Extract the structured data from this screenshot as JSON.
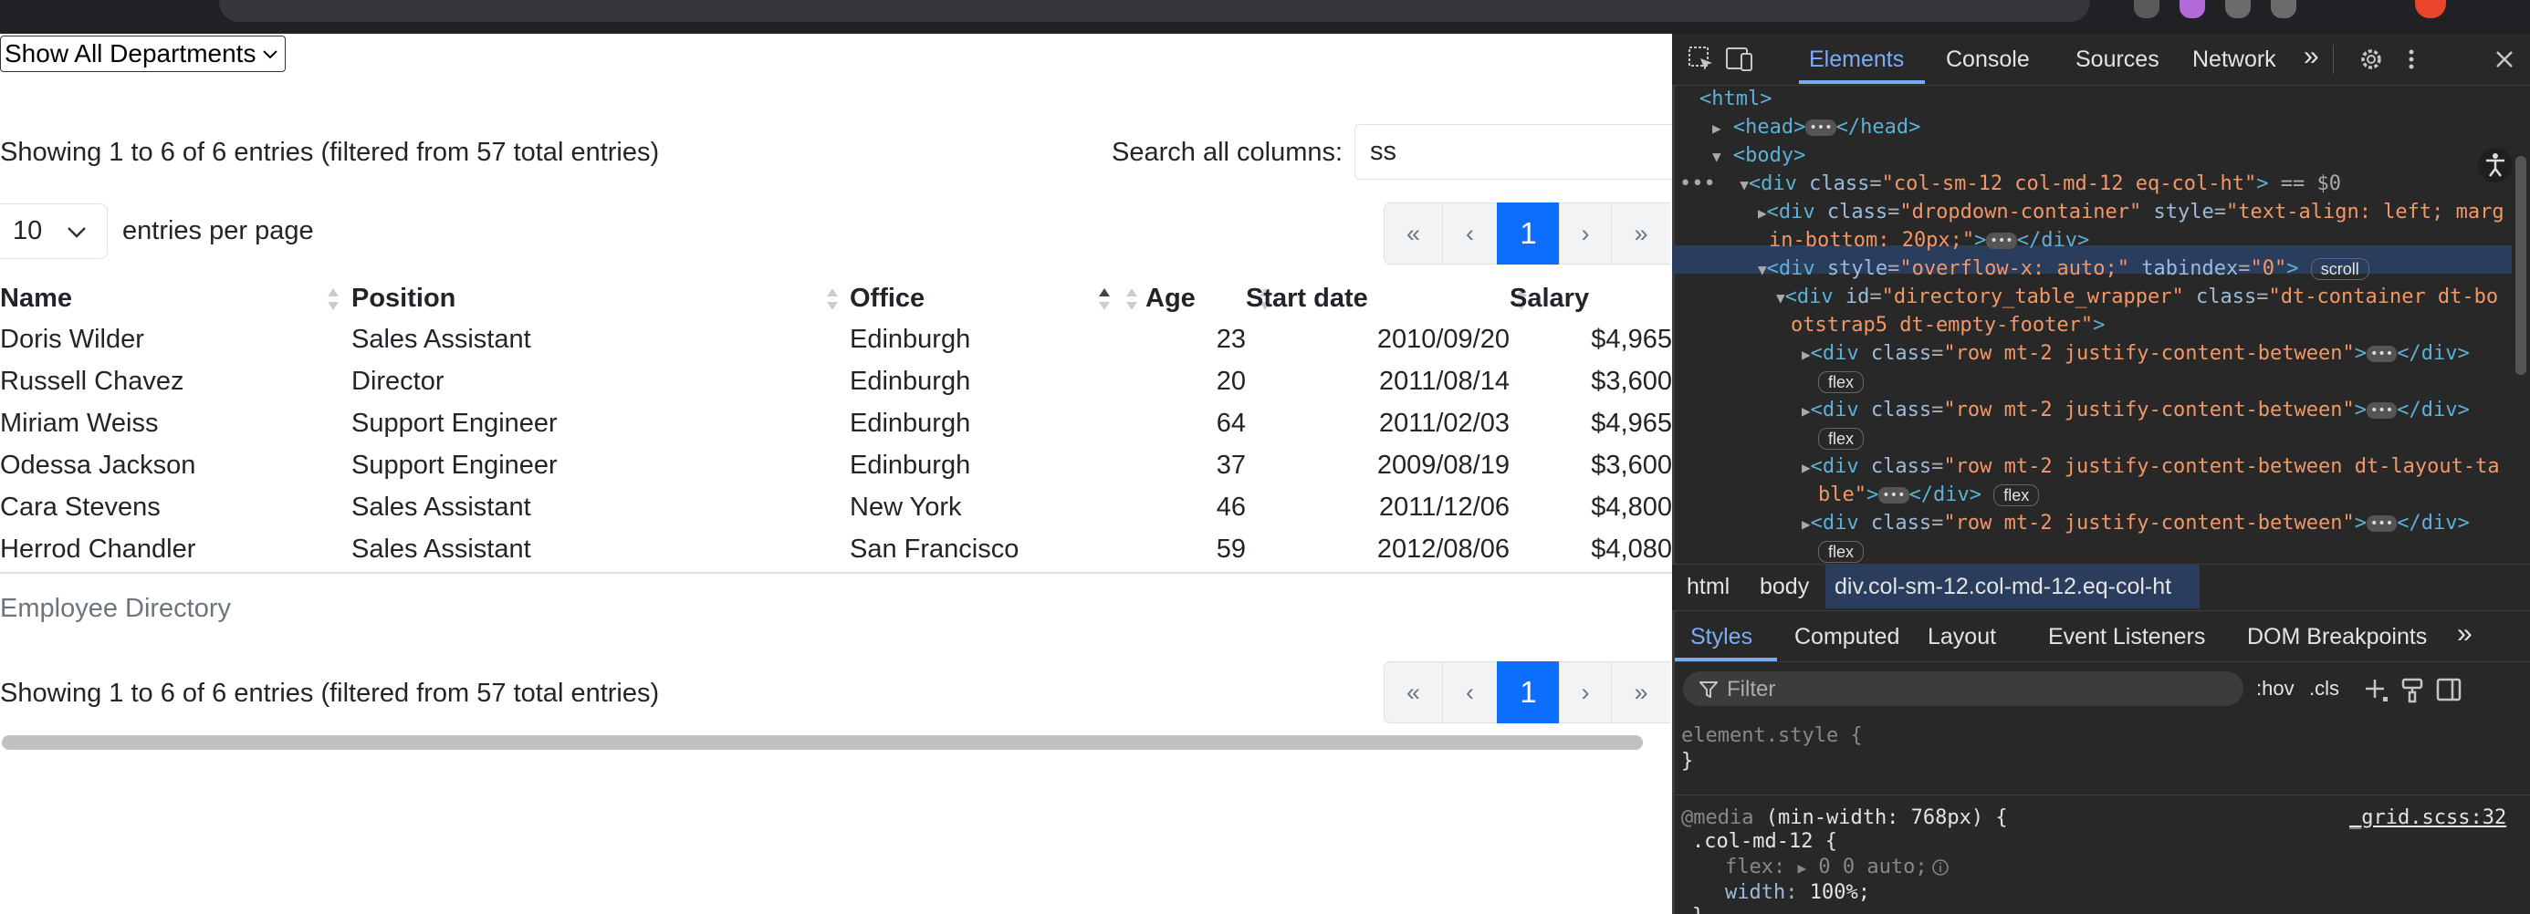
{
  "page": {
    "department_select": "Show All Departments",
    "info_top": "Showing 1 to 6 of 6 entries (filtered from 57 total entries)",
    "info_bottom": "Showing 1 to 6 of 6 entries (filtered from 57 total entries)",
    "search_label": "Search all columns:",
    "search_value": "ss",
    "page_length": "10",
    "page_length_label": "entries per page",
    "pager": {
      "first": "«",
      "prev": "‹",
      "current": "1",
      "next": "›",
      "last": "»"
    },
    "caption": "Employee Directory",
    "columns": [
      "Name",
      "Position",
      "Office",
      "Age",
      "Start date",
      "Salary"
    ],
    "rows": [
      [
        "Doris Wilder",
        "Sales Assistant",
        "Edinburgh",
        "23",
        "2010/09/20",
        "$4,965"
      ],
      [
        "Russell Chavez",
        "Director",
        "Edinburgh",
        "20",
        "2011/08/14",
        "$3,600"
      ],
      [
        "Miriam Weiss",
        "Support Engineer",
        "Edinburgh",
        "64",
        "2011/02/03",
        "$4,965"
      ],
      [
        "Odessa Jackson",
        "Support Engineer",
        "Edinburgh",
        "37",
        "2009/08/19",
        "$3,600"
      ],
      [
        "Cara Stevens",
        "Sales Assistant",
        "New York",
        "46",
        "2011/12/06",
        "$4,800"
      ],
      [
        "Herrod Chandler",
        "Sales Assistant",
        "San Francisco",
        "59",
        "2012/08/06",
        "$4,080"
      ]
    ],
    "sorted_column": "Office",
    "sort_direction": "ascending"
  },
  "devtools": {
    "tabs": [
      "Elements",
      "Console",
      "Sources",
      "Network"
    ],
    "active_tab": "Elements",
    "more_tabs": "»",
    "dom": {
      "html": "<html>",
      "head_open": "<head>",
      "head_close": "</head>",
      "body": "<body>",
      "div_open": "<div",
      "div_close": "</div>",
      "class_attr": "class",
      "style_attr": "style",
      "id_attr": "id",
      "tabindex_attr": "tabindex",
      "selected_class": "\"col-sm-12 col-md-12 eq-col-ht\"",
      "selected_suffix": "== $0",
      "dropdown_class": "\"dropdown-container\"",
      "dropdown_style_1": "\"text-align: left; marg",
      "dropdown_style_2": "in-bottom: 20px;\"",
      "overflow_style": "\"overflow-x: auto;\"",
      "tabindex_value": "\"0\"",
      "scroll_badge": "scroll",
      "wrapper_id": "\"directory_table_wrapper\"",
      "wrapper_class_1": "\"dt-container dt-bo",
      "wrapper_class_2": "otstrap5 dt-empty-footer\"",
      "row_class": "\"row mt-2 justify-content-between\"",
      "row_class_layout_1": "\"row mt-2 justify-content-between dt-layout-ta",
      "row_class_layout_2": "ble\"",
      "flex_badge": "flex"
    },
    "breadcrumb": [
      "html",
      "body",
      "div.col-sm-12.col-md-12.eq-col-ht"
    ],
    "style_tabs": [
      "Styles",
      "Computed",
      "Layout",
      "Event Listeners",
      "DOM Breakpoints"
    ],
    "active_style_tab": "Styles",
    "filter_placeholder": "Filter",
    "hov": ":hov",
    "cls": ".cls",
    "styles": {
      "element_style": "element.style {",
      "close_brace": "}",
      "media": "@media",
      "media_query": "(min-width: 768px) {",
      "source": "_grid.scss:32",
      "selector": ".col-md-12 {",
      "prop1_name": "flex:",
      "prop1_value": "0 0 auto;",
      "prop2_name": "width:",
      "prop2_value": "100%;"
    }
  }
}
